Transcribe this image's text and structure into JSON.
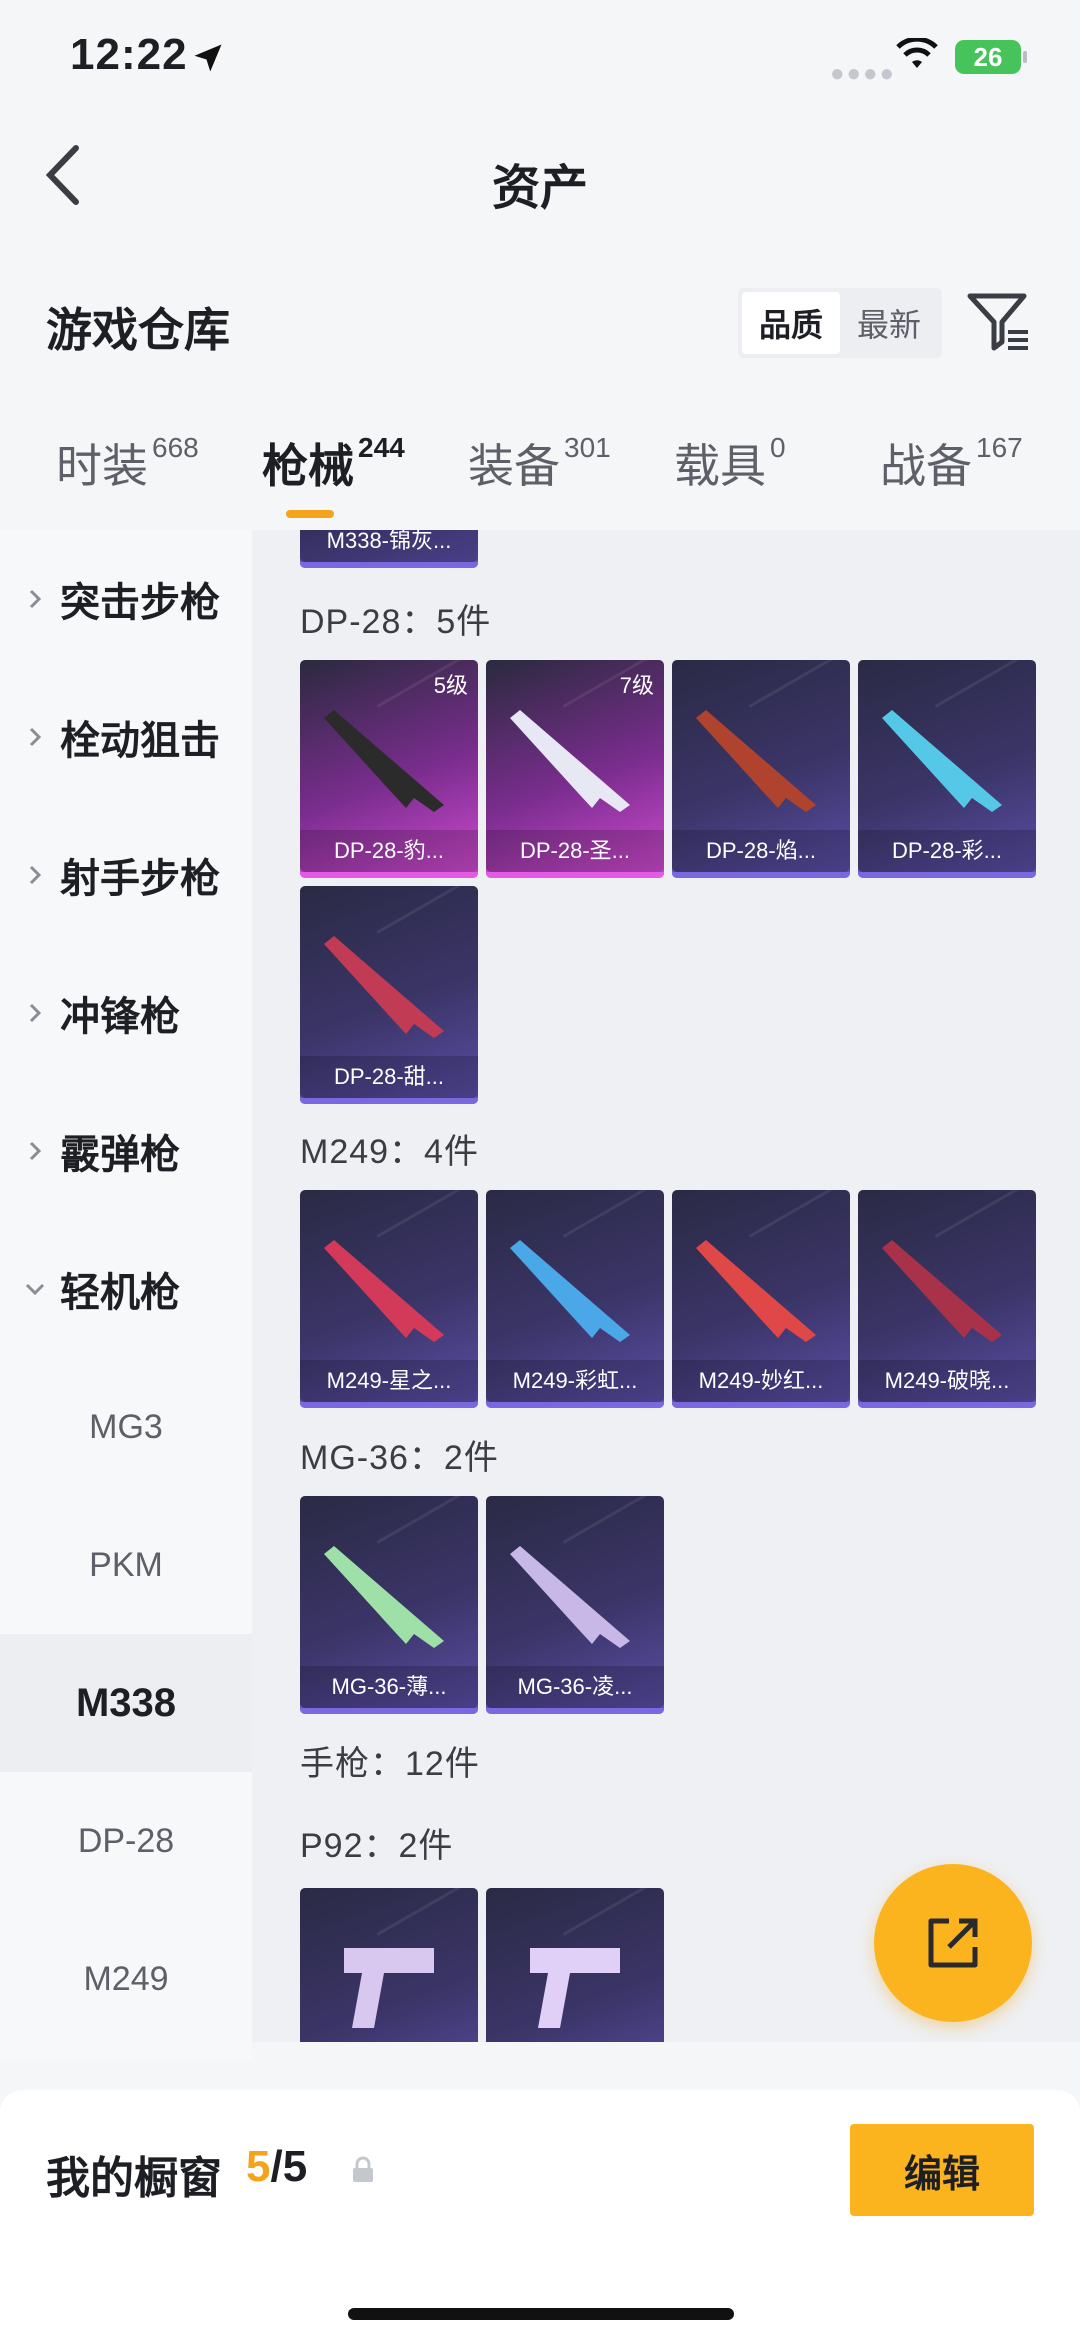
{
  "status_bar": {
    "time": "12:22",
    "battery": "26"
  },
  "nav": {
    "title": "资产"
  },
  "header": {
    "section_title": "游戏仓库",
    "sort_options": [
      "品质",
      "最新"
    ],
    "sort_active": "品质"
  },
  "tabs": [
    {
      "label": "时装",
      "count": "668"
    },
    {
      "label": "枪械",
      "count": "244",
      "active": true
    },
    {
      "label": "装备",
      "count": "301"
    },
    {
      "label": "载具",
      "count": "0"
    },
    {
      "label": "战备",
      "count": "167"
    }
  ],
  "sidebar": {
    "categories": [
      "突击步枪",
      "栓动狙击",
      "射手步枪",
      "冲锋枪",
      "霰弹枪",
      "轻机枪"
    ],
    "subitems": [
      "MG3",
      "PKM",
      "M338",
      "DP-28",
      "M249"
    ],
    "active_subitem": "M338"
  },
  "content": {
    "top_partial_card": "M338-锦灰...",
    "groups": [
      {
        "label": "DP-28：5件",
        "items": [
          {
            "name": "DP-28-豹...",
            "level": "5级",
            "rarity": "pink",
            "color": "#2b2b2b"
          },
          {
            "name": "DP-28-圣...",
            "level": "7级",
            "rarity": "pink",
            "color": "#e8e8f5"
          },
          {
            "name": "DP-28-焰...",
            "level": "",
            "rarity": "purple",
            "color": "#b0432e"
          },
          {
            "name": "DP-28-彩...",
            "level": "",
            "rarity": "purple",
            "color": "#55c8e8"
          },
          {
            "name": "DP-28-甜...",
            "level": "",
            "rarity": "purple",
            "color": "#c23b55"
          }
        ]
      },
      {
        "label": "M249：4件",
        "items": [
          {
            "name": "M249-星之...",
            "level": "",
            "rarity": "purple",
            "color": "#d33a5a"
          },
          {
            "name": "M249-彩虹...",
            "level": "",
            "rarity": "purple",
            "color": "#4aa8e8"
          },
          {
            "name": "M249-妙红...",
            "level": "",
            "rarity": "purple",
            "color": "#e04848"
          },
          {
            "name": "M249-破晓...",
            "level": "",
            "rarity": "purple",
            "color": "#a8324a"
          }
        ]
      },
      {
        "label": "MG-36：2件",
        "items": [
          {
            "name": "MG-36-薄...",
            "level": "",
            "rarity": "purple",
            "color": "#9ee0a8"
          },
          {
            "name": "MG-36-凌...",
            "level": "",
            "rarity": "purple",
            "color": "#c8b8e8"
          }
        ]
      },
      {
        "label": "手枪：12件",
        "items": []
      },
      {
        "label": "P92：2件",
        "items": [
          {
            "name": "",
            "level": "",
            "rarity": "purple",
            "color": "#d8c8f0"
          },
          {
            "name": "",
            "level": "",
            "rarity": "purple",
            "color": "#e0d0f8"
          }
        ]
      }
    ]
  },
  "bottom_bar": {
    "label": "我的橱窗",
    "count_current": "5",
    "count_total": "/5",
    "edit_label": "编辑"
  }
}
